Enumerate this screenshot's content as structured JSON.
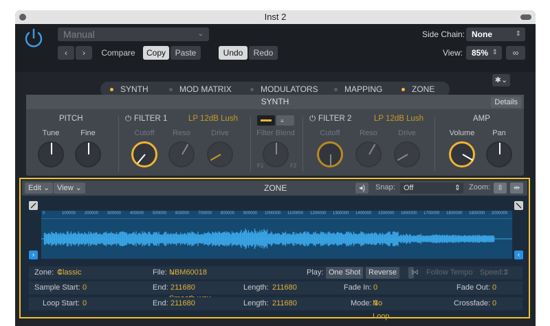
{
  "window": {
    "title": "Inst 2"
  },
  "header": {
    "preset": "Manual",
    "compare": "Compare",
    "copy": "Copy",
    "paste": "Paste",
    "undo": "Undo",
    "redo": "Redo",
    "side_chain_label": "Side Chain:",
    "side_chain_value": "None",
    "view_label": "View:",
    "view_value": "85%"
  },
  "tabs": [
    {
      "label": "SYNTH",
      "active": true
    },
    {
      "label": "MOD MATRIX",
      "active": false
    },
    {
      "label": "MODULATORS",
      "active": false
    },
    {
      "label": "MAPPING",
      "active": false
    },
    {
      "label": "ZONE",
      "active": true
    }
  ],
  "synth": {
    "title": "SYNTH",
    "details": "Details",
    "pitch": {
      "title": "PITCH",
      "tune": "Tune",
      "fine": "Fine"
    },
    "filter1": {
      "title": "FILTER 1",
      "type": "LP 12dB Lush",
      "cutoff": "Cutoff",
      "reso": "Reso",
      "drive": "Drive"
    },
    "blend": {
      "label": "Filter Blend",
      "f1": "F1",
      "f2": "F2"
    },
    "filter2": {
      "title": "FILTER 2",
      "type": "LP 12dB Lush",
      "cutoff": "Cutoff",
      "reso": "Reso",
      "drive": "Drive"
    },
    "amp": {
      "title": "AMP",
      "volume": "Volume",
      "pan": "Pan"
    }
  },
  "zone": {
    "edit": "Edit",
    "view": "View",
    "title": "ZONE",
    "snap_label": "Snap:",
    "snap_value": "Off",
    "zoom_label": "Zoom:",
    "ruler": [
      "0",
      "100000",
      "200000",
      "300000",
      "400000",
      "500000",
      "600000",
      "700000",
      "800000",
      "900000",
      "1000000",
      "1100000",
      "1200000",
      "1300000",
      "1400000",
      "1500000",
      "1600000",
      "1700000",
      "1800000",
      "1900000",
      "2000000"
    ],
    "zone_label": "Zone:",
    "zone_value": "Classic Zone",
    "file_label": "File:",
    "file_value": "NBM60018 Gu...n Smooth.wav",
    "play_label": "Play:",
    "one_shot": "One Shot",
    "reverse": "Reverse",
    "follow_tempo": "Follow Tempo",
    "speed_label": "Speed:",
    "speed_value": "1",
    "sample_start_label": "Sample Start:",
    "sample_start": "0",
    "end_label": "End:",
    "end1": "211680",
    "length_label": "Length:",
    "length1": "211680",
    "fade_in_label": "Fade In:",
    "fade_in": "0",
    "fade_out_label": "Fade Out:",
    "fade_out": "0",
    "loop_start_label": "Loop Start:",
    "loop_start": "0",
    "end2": "211680",
    "length2": "211680",
    "mode_label": "Mode:",
    "mode_value": "No Loop",
    "crossfade_label": "Crossfade:",
    "crossfade": "0"
  },
  "colors": {
    "accent": "#f5c02d",
    "wave": "#3aa6e8",
    "bg": "#21252b"
  }
}
